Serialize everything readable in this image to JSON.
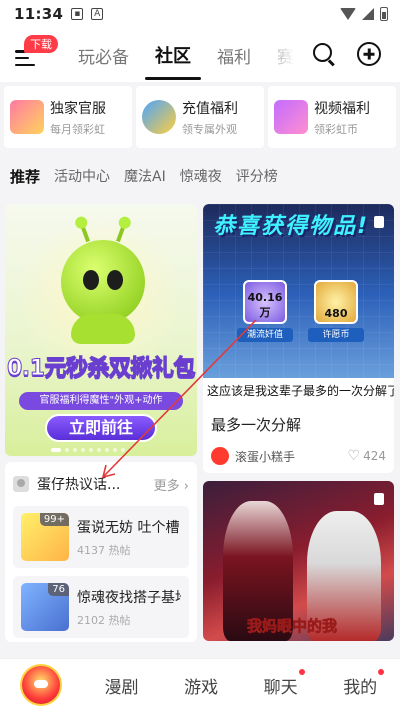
{
  "status_bar": {
    "time": "11:34",
    "icon_a": "A"
  },
  "top_nav": {
    "download_badge": "下载",
    "tabs": [
      {
        "label": "玩必备",
        "active": false
      },
      {
        "label": "社区",
        "active": true
      },
      {
        "label": "福利",
        "active": false
      },
      {
        "label": "赛",
        "active": false
      }
    ]
  },
  "benefits": [
    {
      "title": "独家官服",
      "subtitle": "每月领彩虹",
      "icon": "gift-box-icon"
    },
    {
      "title": "充值福利",
      "subtitle": "领专属外观",
      "icon": "character-icon"
    },
    {
      "title": "视频福利",
      "subtitle": "领彩虹币",
      "icon": "video-gift-icon"
    }
  ],
  "category_tabs": [
    "推荐",
    "活动中心",
    "魔法AI",
    "惊魂夜",
    "评分榜"
  ],
  "promo": {
    "headline": "0.1元秒杀双揪礼包",
    "subline": "官服福利得魔性\"外观+动作",
    "button": "立即前往"
  },
  "hot": {
    "title": "蛋仔热议话...",
    "more": "更多",
    "items": [
      {
        "name": "蛋说无妨 吐个槽...",
        "count": "4137 热帖",
        "badge": "99+"
      },
      {
        "name": "惊魂夜找搭子基地",
        "count": "2102 热帖",
        "badge": "76"
      }
    ]
  },
  "post1": {
    "banner_text": "恭喜获得物品!",
    "item_a_value": "40.16万",
    "item_a_caption": "潮流奸值",
    "item_b_value": "480",
    "item_b_caption": "许愿币",
    "image_caption": "这应该是我这辈子最多的一次分解了",
    "title": "最多一次分解",
    "author": "滚蛋小糕手",
    "likes": "424"
  },
  "post2": {
    "caption": "我妈眼中的我"
  },
  "bottom_nav": [
    {
      "label": "漫剧",
      "dot": false
    },
    {
      "label": "游戏",
      "dot": false
    },
    {
      "label": "聊天",
      "dot": true
    },
    {
      "label": "我的",
      "dot": true
    }
  ],
  "colors": {
    "accent_red": "#ff3b47",
    "annotation_arrow": "#e03a3a"
  }
}
